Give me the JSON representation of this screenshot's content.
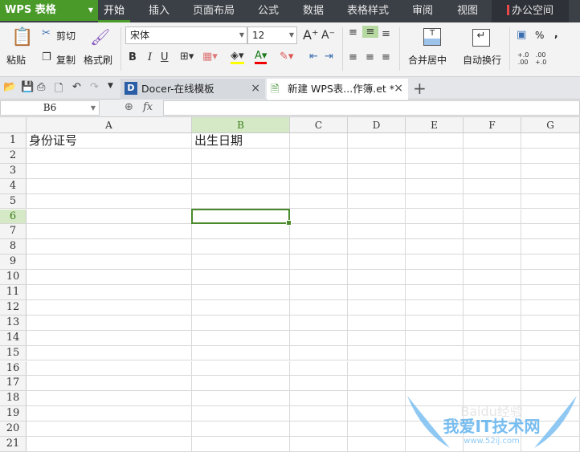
{
  "app": {
    "logo": "WPS 表格"
  },
  "menu_tabs": [
    "开始",
    "插入",
    "页面布局",
    "公式",
    "数据",
    "表格样式",
    "审阅",
    "视图",
    "办公空间"
  ],
  "ribbon": {
    "paste": "粘贴",
    "cut": "剪切",
    "copy": "复制",
    "format_painter": "格式刷",
    "font": "宋体",
    "font_size": "12",
    "merge_center": "合并居中",
    "wrap_text": "自动换行",
    "percent": "%",
    "comma": ","
  },
  "doc_tabs": [
    {
      "label": "Docer-在线模板",
      "close": "×"
    },
    {
      "label": "新建 WPS表...作簿.et *",
      "close": "×"
    }
  ],
  "new_tab": "+",
  "formula_bar": {
    "name_box": "B6",
    "fx": "fx",
    "value": ""
  },
  "columns": [
    "A",
    "B",
    "C",
    "D",
    "E",
    "F",
    "G"
  ],
  "rows": [
    "1",
    "2",
    "3",
    "4",
    "5",
    "6",
    "7",
    "8",
    "9",
    "10",
    "11",
    "12",
    "13",
    "14",
    "15",
    "16",
    "17",
    "18",
    "19",
    "20",
    "21"
  ],
  "cells": {
    "A1": "身份证号",
    "B1": "出生日期"
  },
  "selected_cell": "B6",
  "watermark": {
    "text": "我爱IT技术网",
    "url": "www.52ij.com",
    "brand": "Baidu经验"
  },
  "colors": {
    "accent": "#4a9a2a",
    "titlebar": "#3b3f46"
  }
}
